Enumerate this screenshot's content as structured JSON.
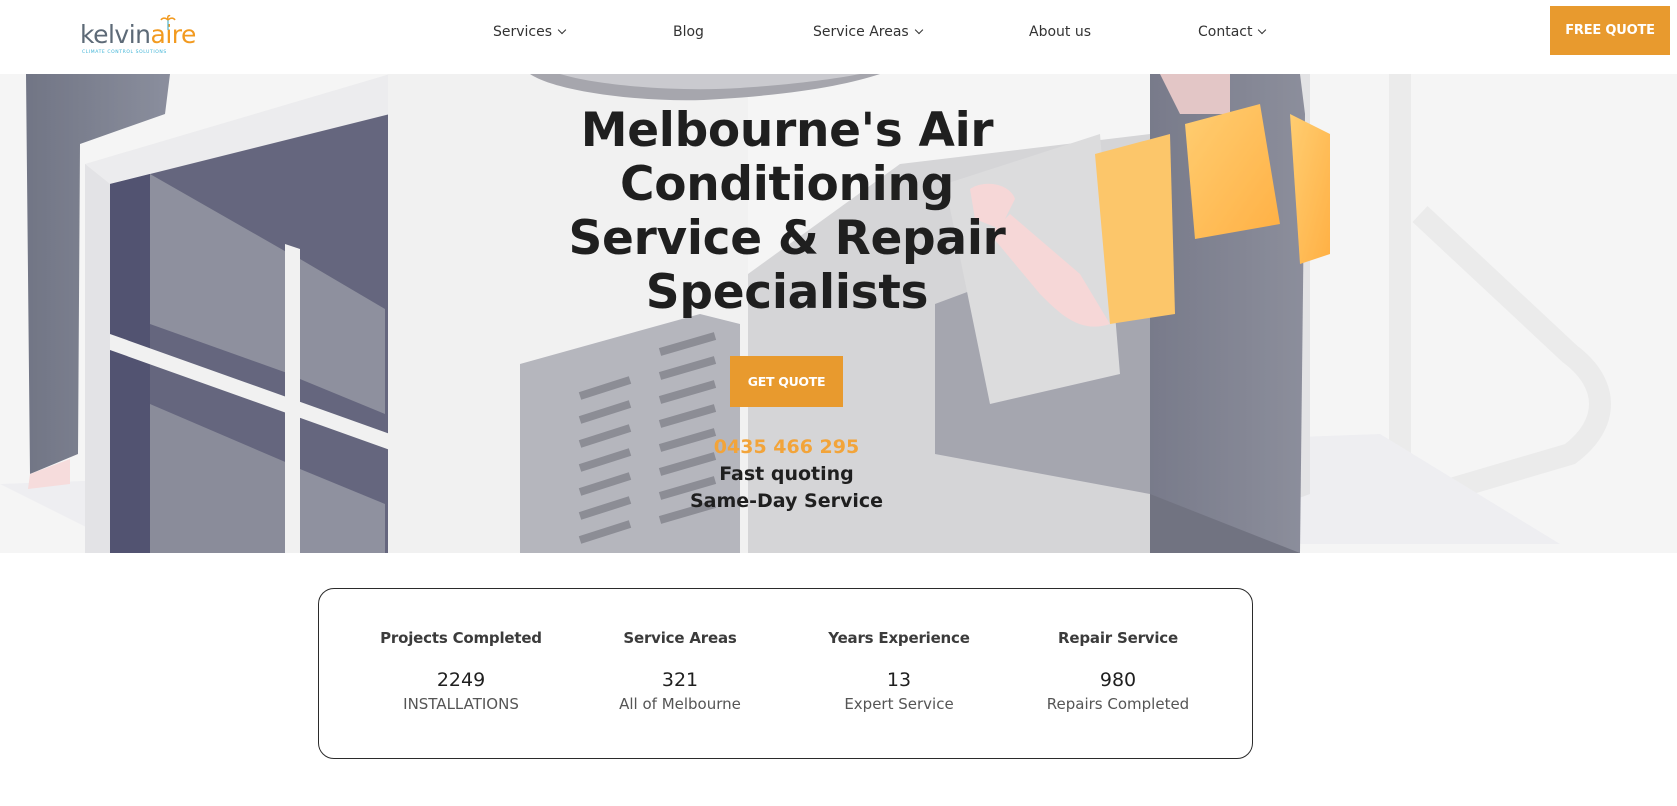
{
  "header": {
    "logo": {
      "part1": "kelvin",
      "part2": "aire",
      "tagline": "CLIMATE CONTROL SOLUTIONS"
    },
    "nav": [
      {
        "label": "Services",
        "dropdown": true
      },
      {
        "label": "Blog",
        "dropdown": false
      },
      {
        "label": "Service Areas",
        "dropdown": true
      },
      {
        "label": "About us",
        "dropdown": false
      },
      {
        "label": "Contact",
        "dropdown": true
      }
    ],
    "cta_label": "FREE QUOTE"
  },
  "hero": {
    "title_lines": [
      "Melbourne's Air",
      "Conditioning",
      "Service & Repair",
      "Specialists"
    ],
    "button_label": "GET QUOTE",
    "phone": "0435 466 295",
    "line1": "Fast quoting",
    "line2": "Same-Day Service"
  },
  "stats": [
    {
      "title": "Projects Completed",
      "value": "2249",
      "sub": "INSTALLATIONS"
    },
    {
      "title": "Service Areas",
      "value": "321",
      "sub": "All of Melbourne"
    },
    {
      "title": "Years Experience",
      "value": "13",
      "sub": "Expert Service"
    },
    {
      "title": "Repair Service",
      "value": "980",
      "sub": "Repairs Completed"
    }
  ],
  "colors": {
    "accent": "#e89a2e",
    "phone": "#f2a43a",
    "text": "#1f1f1f"
  }
}
